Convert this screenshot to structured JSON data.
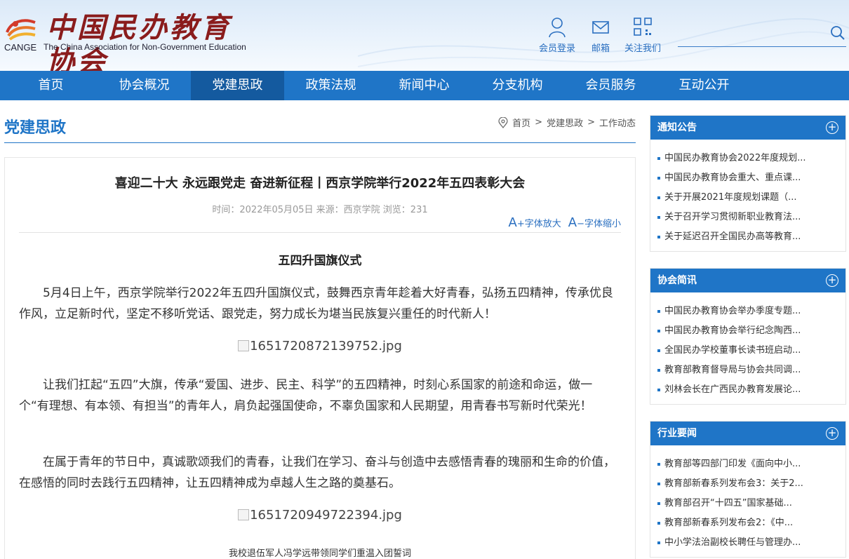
{
  "header": {
    "logo_title": "中国民办教育协会",
    "logo_abbr": "CANGE",
    "logo_en": "The China Association for Non-Government Education",
    "links": [
      {
        "label": "会员登录",
        "icon": "user-icon"
      },
      {
        "label": "邮箱",
        "icon": "mail-icon"
      },
      {
        "label": "关注我们",
        "icon": "qrcode-icon"
      }
    ]
  },
  "nav": {
    "items": [
      "首页",
      "协会概况",
      "党建思政",
      "政策法规",
      "新闻中心",
      "分支机构",
      "会员服务",
      "互动公开"
    ],
    "active": "党建思政"
  },
  "page": {
    "section_title": "党建思政",
    "breadcrumb": [
      "首页",
      ">",
      "党建思政",
      ">",
      "工作动态"
    ]
  },
  "article": {
    "title": "喜迎二十大 永远跟党走 奋进新征程丨西京学院举行2022年五四表彰大会",
    "meta": "时间：2022年05月05日 来源：西京学院 浏览：231",
    "font_larger": "+字体放大",
    "font_smaller": "−字体缩小",
    "subhead": "五四升国旗仪式",
    "paragraphs": [
      "5月4日上午，西京学院举行2022年五四升国旗仪式，鼓舞西京青年趁着大好青春，弘扬五四精神，传承优良作风，立足新时代，坚定不移听党话、跟党走，努力成长为堪当民族复兴重任的时代新人！",
      "让我们扛起“五四”大旗，传承“爱国、进步、民主、科学”的五四精神，时刻心系国家的前途和命运，做一个“有理想、有本领、有担当”的青年人，肩负起强国使命，不辜负国家和人民期望，用青春书写新时代荣光！",
      "在属于青年的节日中，真诚歌颂我们的青春，让我们在学习、奋斗与创造中去感悟青春的瑰丽和生命的价值，在感悟的同时去践行五四精神，让五四精神成为卓越人生之路的奠基石。"
    ],
    "images": [
      "1651720872139752.jpg",
      "1651720949722394.jpg"
    ],
    "caption": "我校退伍军人冯学远带领同学们重温入团誓词"
  },
  "sidebar": [
    {
      "title": "通知公告",
      "items": [
        "中国民办教育协会2022年度规划...",
        "中国民办教育协会重大、重点课...",
        "关于开展2021年度规划课题（...",
        "关于召开学习贯彻新职业教育法...",
        "关于延迟召开全国民办高等教育..."
      ]
    },
    {
      "title": "协会简讯",
      "items": [
        "中国民办教育协会举办季度专题...",
        "中国民办教育协会举行纪念陶西...",
        "全国民办学校董事长读书班启动...",
        "教育部教育督导局与协会共同调...",
        "刘林会长在广西民办教育发展论..."
      ]
    },
    {
      "title": "行业要闻",
      "items": [
        "教育部等四部门印发《面向中小...",
        "教育部新春系列发布会3：关于2...",
        "教育部召开“十四五”国家基础...",
        "教育部新春系列发布会2：《中...",
        "中小学法治副校长聘任与管理办..."
      ]
    }
  ],
  "colors": {
    "primary": "#1f75c7",
    "nav_active": "#145a9f",
    "logo_red": "#8a1c1c"
  }
}
